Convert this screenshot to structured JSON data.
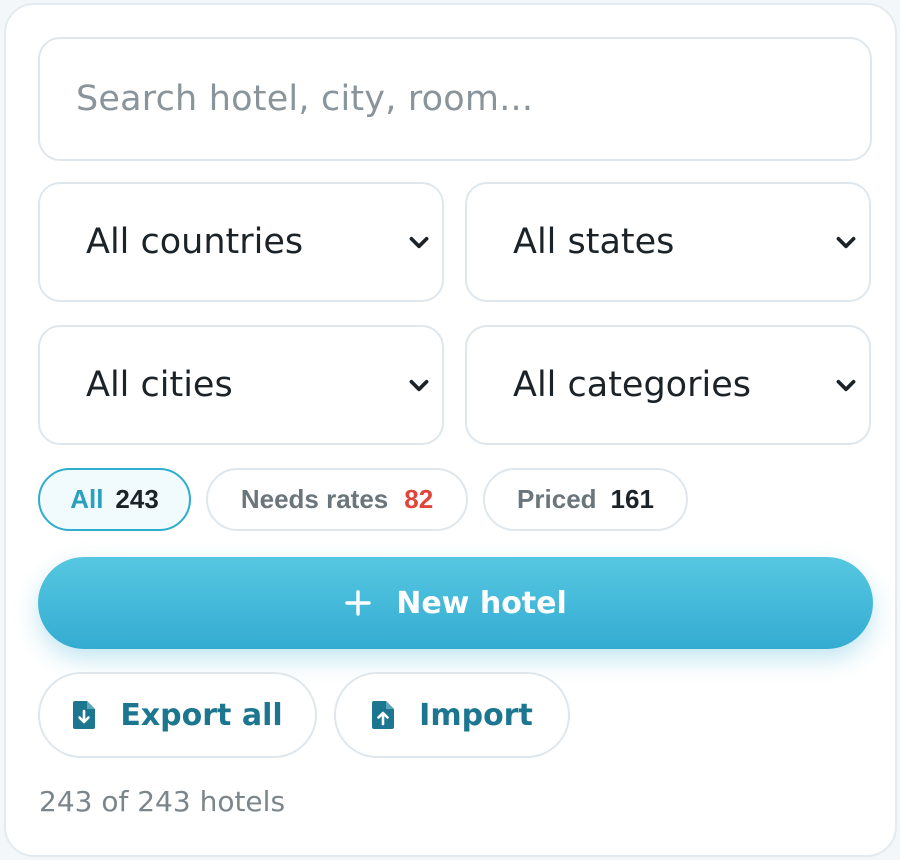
{
  "search": {
    "placeholder": "Search hotel, city, room..."
  },
  "filters": {
    "country": "All countries",
    "state": "All states",
    "city": "All cities",
    "category": "All categories"
  },
  "status_pills": [
    {
      "label": "All",
      "count": "243",
      "active": true
    },
    {
      "label": "Needs rates",
      "count": "82",
      "count_color": "#e0453a"
    },
    {
      "label": "Priced",
      "count": "161"
    }
  ],
  "actions": {
    "new_hotel": "New hotel",
    "export_all": "Export all",
    "import": "Import"
  },
  "summary": "243 of 243 hotels",
  "colors": {
    "accent": "#34acd2",
    "accent_dark": "#1c7690",
    "alert": "#e0453a"
  },
  "icons": {
    "select_chevron": "chevron-down-icon",
    "new": "plus-icon",
    "export": "file-download-icon",
    "import": "file-upload-icon"
  }
}
